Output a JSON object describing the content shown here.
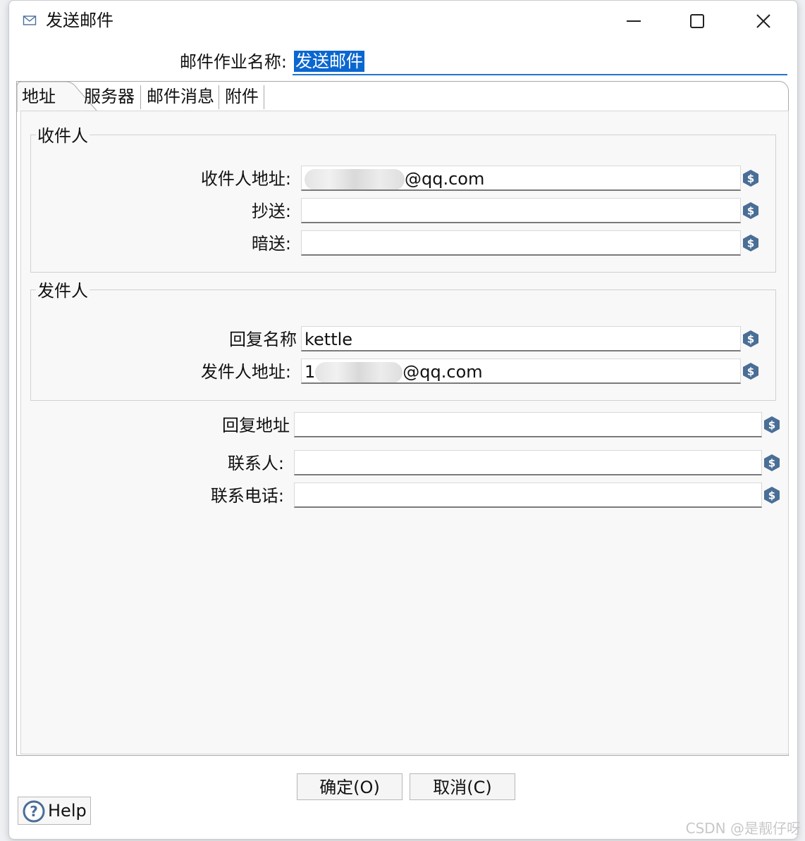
{
  "window": {
    "title": "发送邮件",
    "icon": "mail-icon",
    "controls": {
      "minimize": "minimize-icon",
      "maximize": "maximize-icon",
      "close": "close-icon"
    }
  },
  "job_name": {
    "label": "邮件作业名称:",
    "value": "发送邮件"
  },
  "tabs": [
    {
      "label": "地址",
      "active": true
    },
    {
      "label": "服务器",
      "active": false
    },
    {
      "label": "邮件消息",
      "active": false
    },
    {
      "label": "附件",
      "active": false
    }
  ],
  "recipients": {
    "title": "收件人",
    "to_label": "收件人地址:",
    "to_value_suffix": "@qq.com",
    "cc_label": "抄送:",
    "cc_value": "",
    "bcc_label": "暗送:",
    "bcc_value": ""
  },
  "sender": {
    "title": "发件人",
    "reply_name_label": "回复名称",
    "reply_name_value": "kettle",
    "from_label": "发件人地址:",
    "from_value_prefix": "1",
    "from_value_suffix": "@qq.com"
  },
  "extra": {
    "reply_to_label": "回复地址",
    "reply_to_value": "",
    "contact_label": "联系人:",
    "contact_value": "",
    "phone_label": "联系电话:",
    "phone_value": ""
  },
  "buttons": {
    "ok": "确定(O)",
    "cancel": "取消(C)",
    "help": "Help"
  },
  "variable_icon": "dollar-variable-icon",
  "watermark": "CSDN @是靓仔呀",
  "colors": {
    "accent": "#0b67d0",
    "var_icon": "#4a6e96"
  }
}
